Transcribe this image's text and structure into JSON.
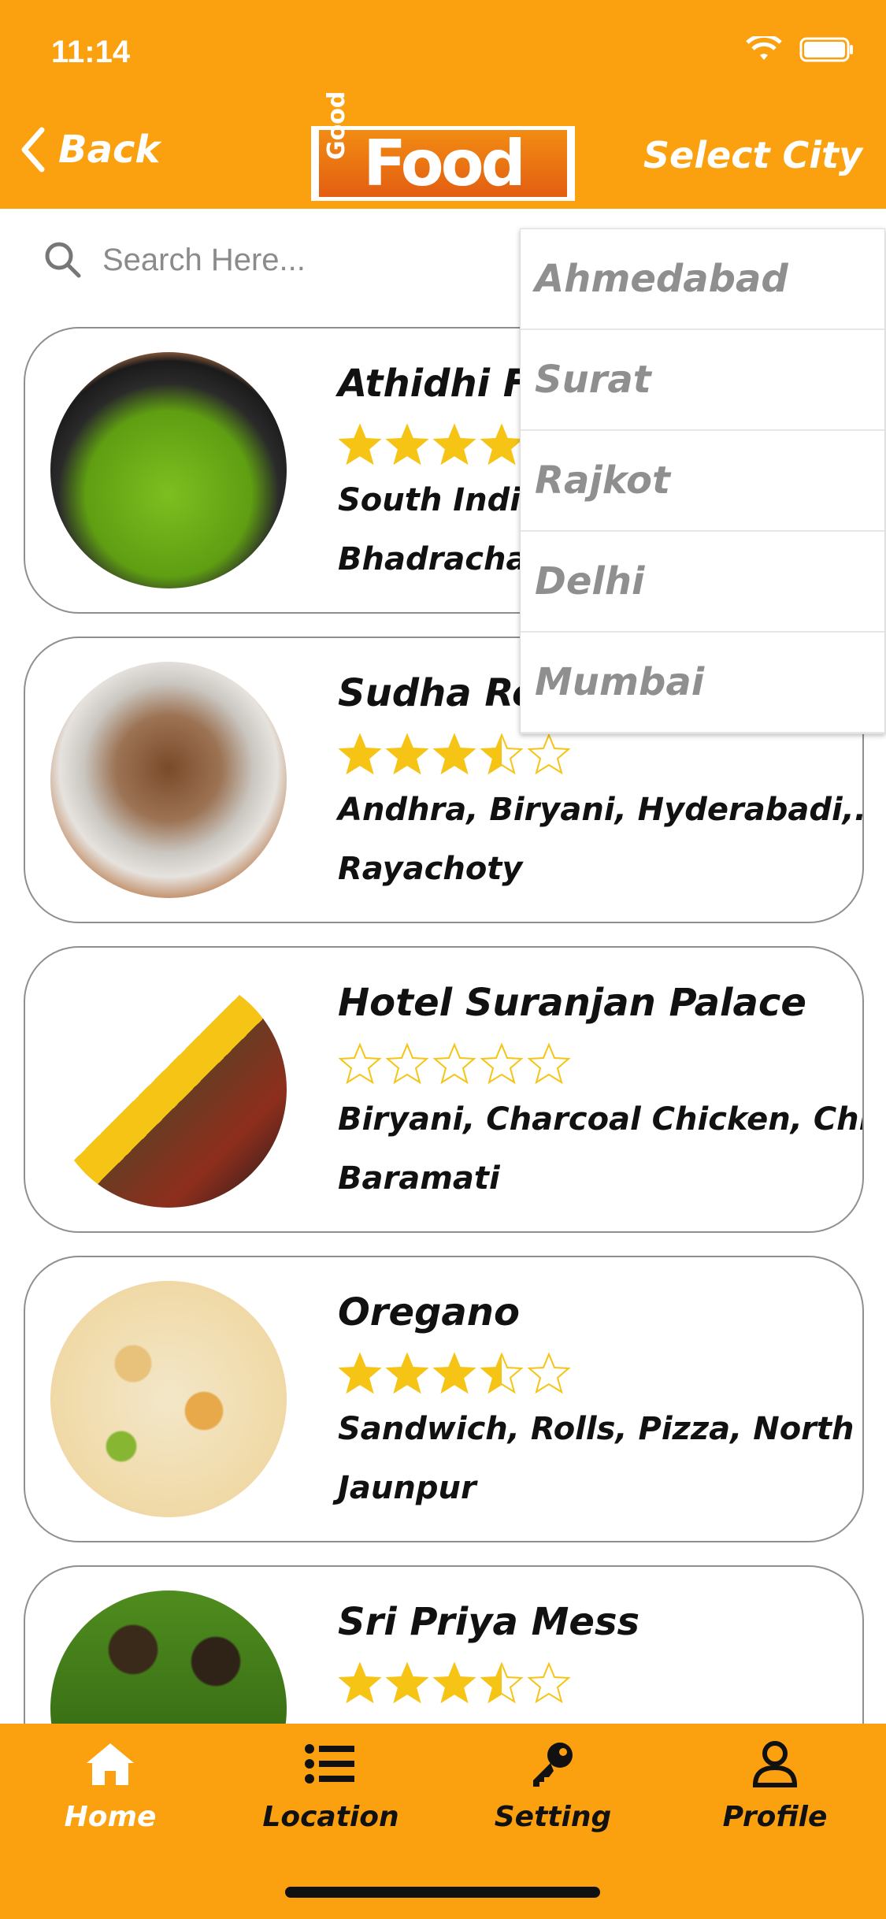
{
  "status": {
    "time": "11:14"
  },
  "header": {
    "back_label": "Back",
    "logo_main": "Food",
    "logo_small": "Good",
    "select_city_label": "Select City"
  },
  "search": {
    "placeholder": "Search Here..."
  },
  "restaurants": [
    {
      "name": "Athidhi Fa",
      "rating": 4.0,
      "cuisine": "South Indian",
      "city": "Bhadrachala"
    },
    {
      "name": "Sudha Res",
      "rating": 3.5,
      "cuisine": "Andhra, Biryani, Hyderabadi,...",
      "city": "Rayachoty"
    },
    {
      "name": "Hotel Suranjan Palace",
      "rating": 0,
      "cuisine": "Biryani, Charcoal Chicken, Chi...",
      "city": "Baramati"
    },
    {
      "name": "Oregano",
      "rating": 3.5,
      "cuisine": "Sandwich, Rolls, Pizza, North I...",
      "city": "Jaunpur"
    },
    {
      "name": "Sri Priya Mess",
      "rating": 3.5,
      "cuisine": "",
      "city": ""
    }
  ],
  "dropdown": {
    "options": [
      "Ahmedabad",
      "Surat",
      "Rajkot",
      "Delhi",
      "Mumbai"
    ]
  },
  "tabs": [
    {
      "label": "Home",
      "icon": "home-icon"
    },
    {
      "label": "Location",
      "icon": "list-icon"
    },
    {
      "label": "Setting",
      "icon": "key-icon"
    },
    {
      "label": "Profile",
      "icon": "user-icon"
    }
  ],
  "colors": {
    "accent": "#FBA10F",
    "star": "#F6C415"
  }
}
